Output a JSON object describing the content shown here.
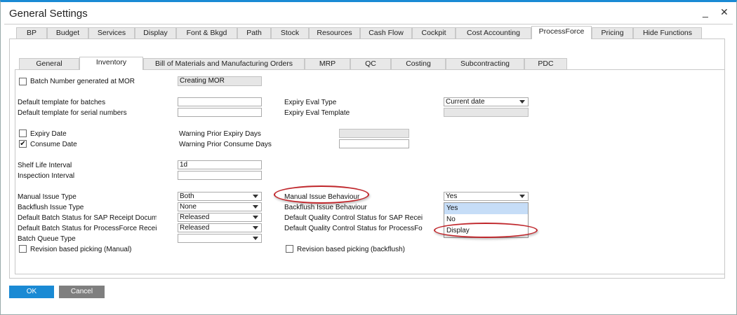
{
  "window": {
    "title": "General Settings",
    "minimize": "_",
    "close": "✕"
  },
  "outer_tabs": [
    "BP",
    "Budget",
    "Services",
    "Display",
    "Font & Bkgd",
    "Path",
    "Stock",
    "Resources",
    "Cash Flow",
    "Cockpit",
    "Cost Accounting",
    "ProcessForce",
    "Pricing",
    "Hide Functions"
  ],
  "outer_active": "ProcessForce",
  "inner_tabs": [
    "General",
    "Inventory",
    "Bill of Materials and Manufacturing Orders",
    "MRP",
    "QC",
    "Costing",
    "Subcontracting",
    "PDC"
  ],
  "inner_active": "Inventory",
  "form": {
    "batch_number_mor": {
      "label": "Batch Number generated at MOR",
      "checked": false,
      "value": "Creating MOR"
    },
    "default_template_batches": {
      "label": "Default template for batches",
      "value": ""
    },
    "default_template_serial": {
      "label": "Default template for serial numbers",
      "value": ""
    },
    "expiry_eval_type": {
      "label": "Expiry Eval Type",
      "value": "Current date"
    },
    "expiry_eval_template": {
      "label": "Expiry Eval Template",
      "value": ""
    },
    "expiry_date": {
      "label": "Expiry Date",
      "checked": false
    },
    "consume_date": {
      "label": "Consume Date",
      "checked": true
    },
    "warning_prior_expiry": {
      "label": "Warning Prior Expiry Days",
      "value": ""
    },
    "warning_prior_consume": {
      "label": "Warning Prior Consume Days",
      "value": ""
    },
    "shelf_life": {
      "label": "Shelf Life Interval",
      "value": "1d"
    },
    "inspection_interval": {
      "label": "Inspection Interval",
      "value": ""
    },
    "manual_issue_type": {
      "label": "Manual Issue Type",
      "value": "Both"
    },
    "backflush_issue_type": {
      "label": "Backflush Issue Type",
      "value": "None"
    },
    "batch_status_sap": {
      "label": "Default Batch Status for SAP Receipt Docume",
      "value": "Released"
    },
    "batch_status_pf": {
      "label": "Default Batch Status for ProcessForce Receip",
      "value": "Released"
    },
    "batch_queue_type": {
      "label": "Batch Queue Type",
      "value": ""
    },
    "revision_manual": {
      "label": "Revision based picking (Manual)",
      "checked": false
    },
    "manual_issue_behaviour": {
      "label": "Manual Issue Behaviour",
      "value": "Yes",
      "options": [
        "Yes",
        "No",
        "Display"
      ],
      "highlighted": "Yes"
    },
    "backflush_issue_behaviour": {
      "label": "Backflush Issue Behaviour"
    },
    "qc_status_sap": {
      "label": "Default Quality Control Status for SAP Recei"
    },
    "qc_status_pf": {
      "label": "Default Quality Control Status for ProcessFo"
    },
    "revision_backflush": {
      "label": "Revision based picking (backflush)",
      "checked": false
    }
  },
  "buttons": {
    "ok": "OK",
    "cancel": "Cancel"
  },
  "colors": {
    "accent": "#1a8ad4",
    "ok_button": "#1a8ad4",
    "cancel_button": "#7f7f7f",
    "annotation": "#c0262b"
  }
}
